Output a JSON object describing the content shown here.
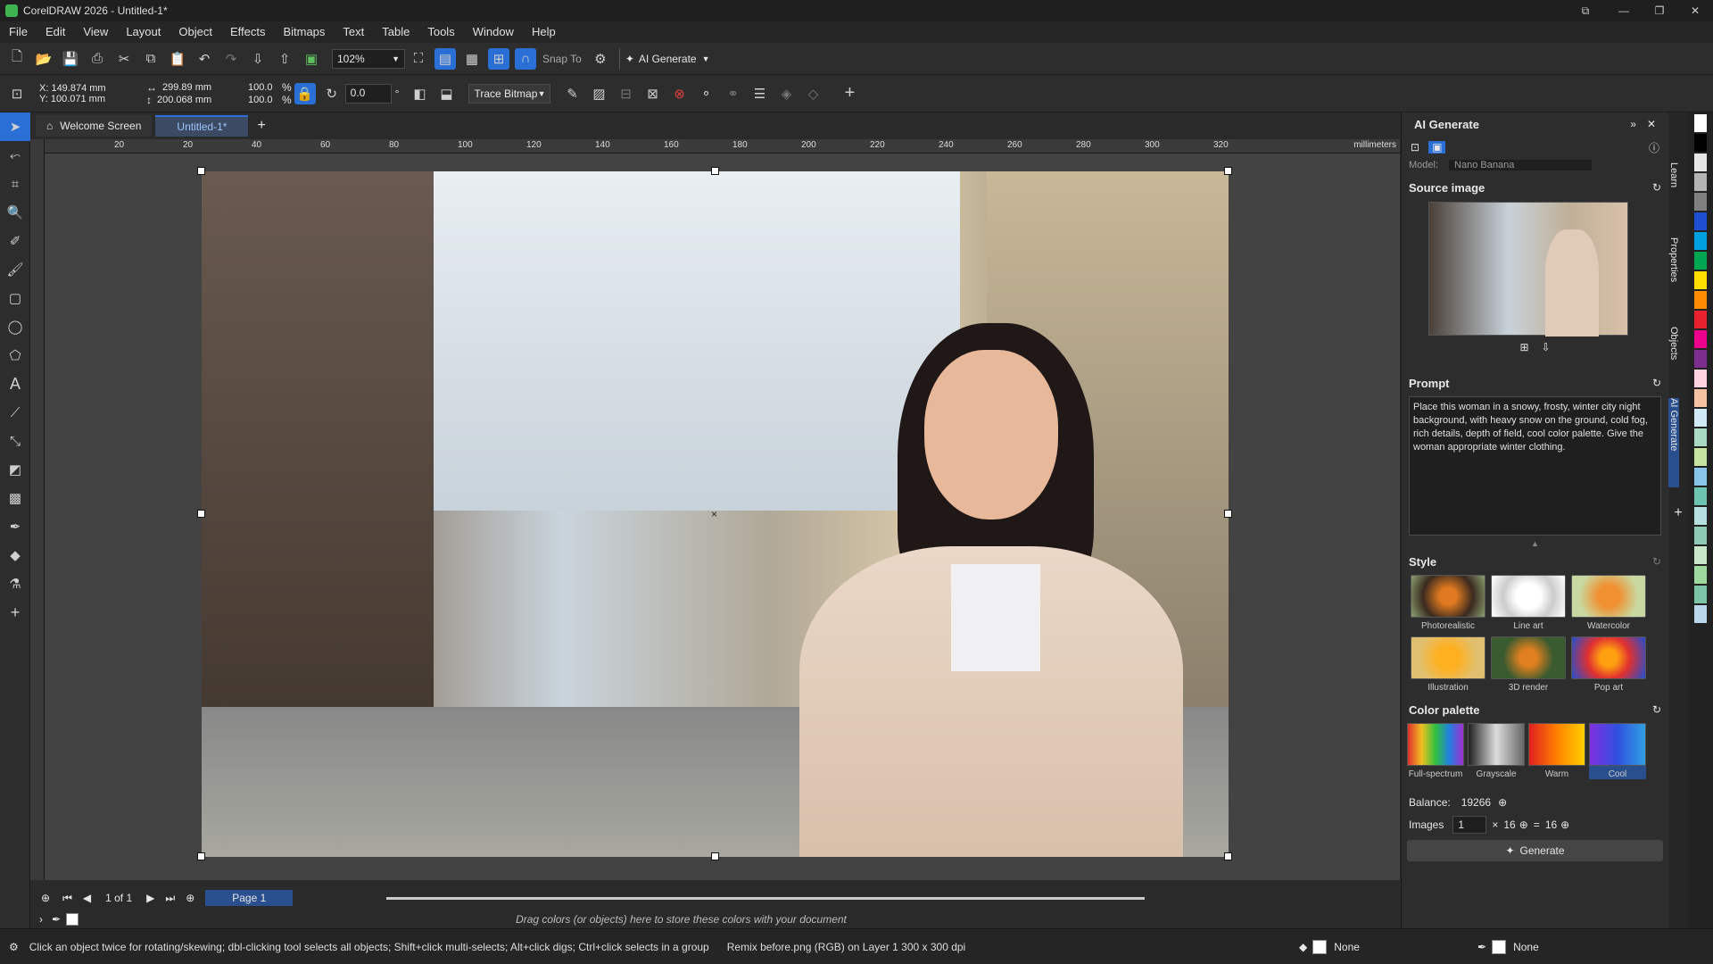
{
  "title": "CorelDRAW 2026 - Untitled-1*",
  "menu": [
    "File",
    "Edit",
    "View",
    "Layout",
    "Object",
    "Effects",
    "Bitmaps",
    "Text",
    "Table",
    "Tools",
    "Window",
    "Help"
  ],
  "toolbar": {
    "zoom": "102%",
    "snap": "Snap To",
    "ai_generate": "AI Generate"
  },
  "props": {
    "x": "X: 149.874 mm",
    "y": "Y: 100.071 mm",
    "w": "299.89 mm",
    "h": "200.068 mm",
    "sx": "100.0",
    "sy": "100.0",
    "pct": "%",
    "rot": "0.0",
    "deg": "°",
    "trace": "Trace Bitmap"
  },
  "tabs": {
    "welcome": "Welcome Screen",
    "doc": "Untitled-1*"
  },
  "ruler": {
    "ticks": [
      "20",
      "20",
      "40",
      "60",
      "80",
      "100",
      "120",
      "140",
      "160",
      "180",
      "200",
      "220",
      "240",
      "260",
      "280",
      "300",
      "320"
    ],
    "unit": "millimeters"
  },
  "page": {
    "count": "1 of 1",
    "name": "Page 1"
  },
  "palette_hint": "Drag colors (or objects) here to store these colors with your document",
  "status": {
    "hint": "Click an object twice for rotating/skewing; dbl-clicking tool selects all objects; Shift+click multi-selects; Alt+click digs; Ctrl+click selects in a group",
    "info": "Remix before.png (RGB) on Layer 1 300 x 300 dpi",
    "fill": "None",
    "outline": "None"
  },
  "panel": {
    "title": "AI Generate",
    "model_label": "Model:",
    "model_value": "Nano Banana",
    "source": "Source image",
    "prompt_label": "Prompt",
    "prompt": "Place this woman in a snowy, frosty, winter city night background, with heavy snow on the ground, cold fog, rich details, depth of field, cool color palette. Give the woman appropriate winter clothing.",
    "style_label": "Style",
    "styles": [
      "Photorealistic",
      "Line art",
      "Watercolor",
      "Illustration",
      "3D render",
      "Pop art"
    ],
    "palette_label": "Color palette",
    "palettes": [
      "Full-spectrum",
      "Grayscale",
      "Warm",
      "Cool"
    ],
    "balance_label": "Balance:",
    "balance": "19266",
    "images_label": "Images",
    "images": "1",
    "x": "×",
    "cost": "16",
    "eq": "=",
    "total": "16",
    "generate": "Generate"
  },
  "dockers": [
    "Learn",
    "Properties",
    "Objects",
    "AI Generate"
  ],
  "colors": {
    "accent": "#2a6fd6",
    "swatches": [
      "#ffffff",
      "#000000",
      "#e6e6e6",
      "#b3b3b3",
      "#808080",
      "#1f4fd1",
      "#00a0e0",
      "#00a651",
      "#ffde00",
      "#ff8c00",
      "#e8212e",
      "#ec008c",
      "#7b2e8e",
      "#ffd3e0",
      "#f5c1a0",
      "#d1e8f5",
      "#a9d9c2",
      "#c6e3a0",
      "#89c4e9",
      "#6bc3b0",
      "#b6dfe0",
      "#8ec9b5",
      "#c8e6c9",
      "#9fd89f",
      "#7cc3a8",
      "#b9d7ea"
    ]
  }
}
